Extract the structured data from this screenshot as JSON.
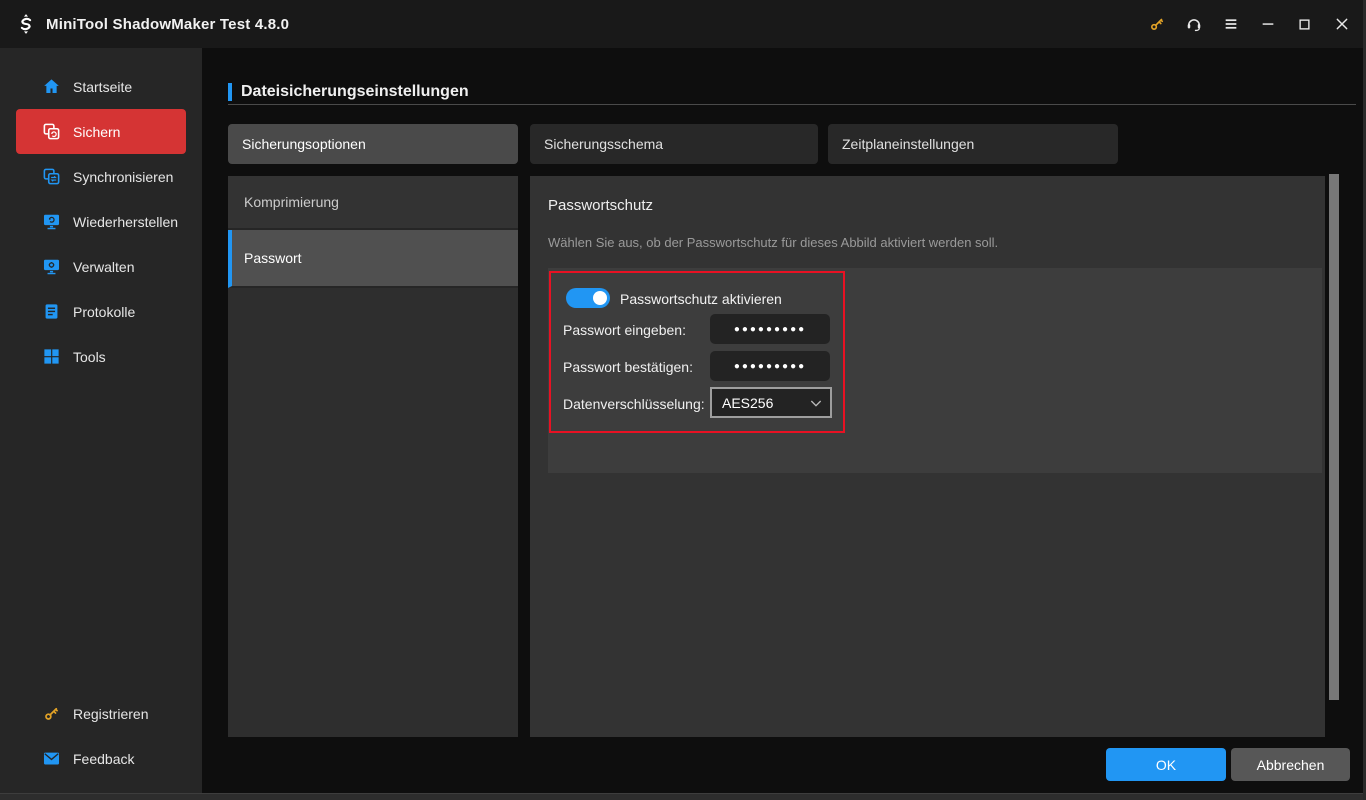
{
  "titlebar": {
    "title": "MiniTool ShadowMaker Test 4.8.0"
  },
  "sidebar": {
    "items": [
      {
        "label": "Startseite",
        "icon": "home-icon",
        "active": false
      },
      {
        "label": "Sichern",
        "icon": "backup-icon",
        "active": true
      },
      {
        "label": "Synchronisieren",
        "icon": "sync-icon",
        "active": false
      },
      {
        "label": "Wiederherstellen",
        "icon": "restore-icon",
        "active": false
      },
      {
        "label": "Verwalten",
        "icon": "manage-icon",
        "active": false
      },
      {
        "label": "Protokolle",
        "icon": "logs-icon",
        "active": false
      },
      {
        "label": "Tools",
        "icon": "tools-icon",
        "active": false
      }
    ],
    "footer_items": [
      {
        "label": "Registrieren",
        "icon": "key-icon"
      },
      {
        "label": "Feedback",
        "icon": "mail-icon"
      }
    ]
  },
  "main": {
    "page_title": "Dateisicherungseinstellungen",
    "tabs": [
      {
        "label": "Sicherungsoptionen",
        "active": true
      },
      {
        "label": "Sicherungsschema",
        "active": false
      },
      {
        "label": "Zeitplaneinstellungen",
        "active": false
      }
    ],
    "options": [
      {
        "label": "Komprimierung",
        "active": false
      },
      {
        "label": "Passwort",
        "active": true
      }
    ],
    "panel": {
      "heading": "Passwortschutz",
      "description": "Wählen Sie aus, ob der Passwortschutz für dieses Abbild aktiviert werden soll.",
      "toggle_label": "Passwortschutz aktivieren",
      "toggle_state": "on",
      "password_label": "Passwort eingeben:",
      "password_value": "●●●●●●●●●",
      "confirm_label": "Passwort bestätigen:",
      "confirm_value": "●●●●●●●●●",
      "encryption_label": "Datenverschlüsselung:",
      "encryption_value": "AES256"
    },
    "footer": {
      "ok_label": "OK",
      "cancel_label": "Abbrechen"
    }
  },
  "colors": {
    "accent_blue": "#2196f3",
    "sidebar_active_red": "#d53434",
    "annotation_red": "#e81123",
    "key_gold": "#e2a226"
  }
}
